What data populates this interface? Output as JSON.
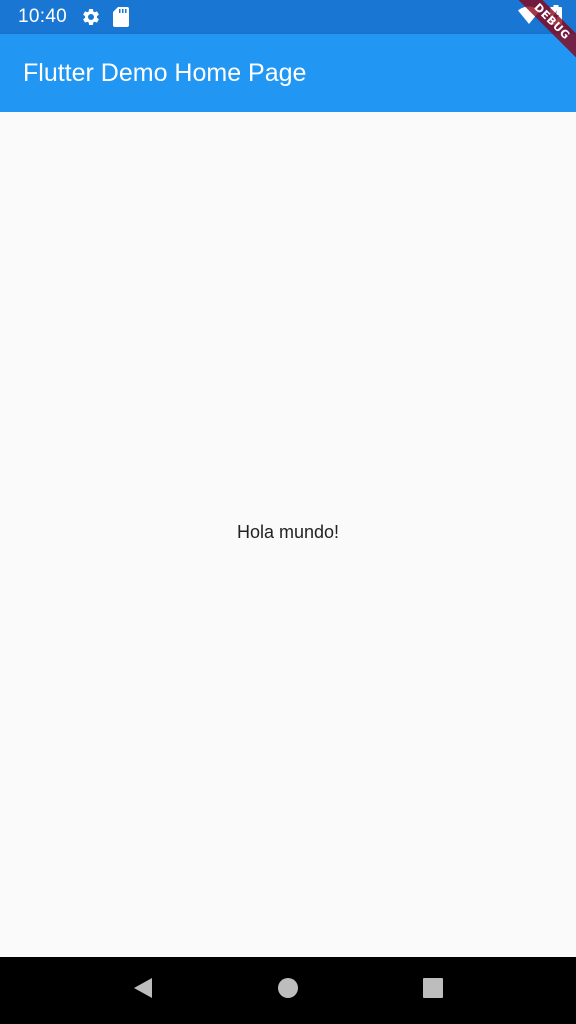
{
  "status_bar": {
    "time": "10:40",
    "icons_left": [
      "gear-icon",
      "sd-card-icon"
    ],
    "icons_right": [
      "wifi-icon",
      "battery-charging-icon"
    ],
    "background": "#1976D2"
  },
  "app_bar": {
    "title": "Flutter Demo Home Page",
    "background": "#2196F3"
  },
  "debug_banner": {
    "label": "DEBUG"
  },
  "body": {
    "text": "Hola mundo!",
    "background": "#fafafa"
  },
  "nav_bar": {
    "buttons": [
      "back-icon",
      "home-icon",
      "recents-icon"
    ],
    "background": "#000000"
  }
}
